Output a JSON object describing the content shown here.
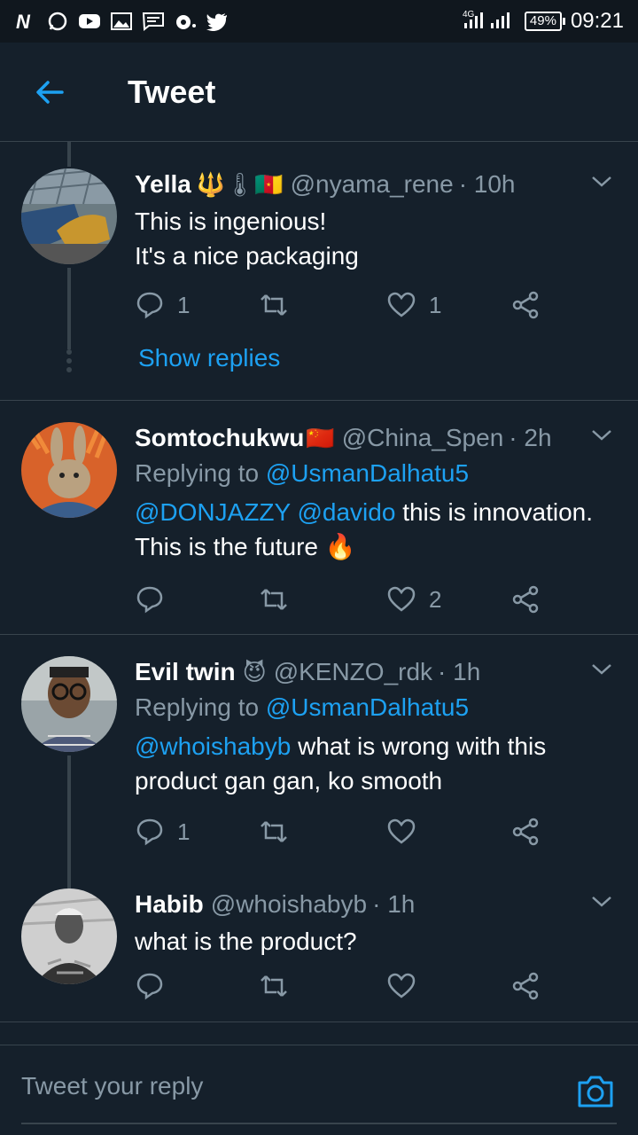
{
  "status_bar": {
    "left_icons": [
      "netflix-n-icon",
      "whatsapp-icon",
      "youtube-icon",
      "gallery-icon",
      "message-icon",
      "music-icon",
      "twitter-icon"
    ],
    "network": "4G",
    "battery": "49%",
    "time": "09:21"
  },
  "header": {
    "title": "Tweet"
  },
  "tweets": [
    {
      "name": "Yella",
      "badges": "🔱🌡🇨🇲",
      "handle": "@nyama_rene",
      "time": "· 10h",
      "replying_label": "",
      "replying_to": "",
      "text_lines": [
        "This is ingenious!",
        "It's a nice packaging"
      ],
      "reply_count": "1",
      "like_count": "1",
      "show_replies": "Show replies"
    },
    {
      "name": "Somtochukwu",
      "badges": "🇨🇳",
      "handle": "@China_Spen",
      "time": "· 2h",
      "replying_label": "Replying to",
      "replying_to": "@UsmanDalhatu5",
      "mention_1": "@DONJAZZY",
      "mention_2": "@davido",
      "text_after": "this is innovation.",
      "text_line2": "This is the future 🔥",
      "reply_count": "",
      "like_count": "2"
    },
    {
      "name": "Evil twin",
      "badges": "😈",
      "handle": "@KENZO_rdk",
      "time": "· 1h",
      "replying_label": "Replying to",
      "replying_to": "@UsmanDalhatu5",
      "mention_1": "@whoishabyb",
      "text_after": "what is wrong with this",
      "text_line2": "product gan gan, ko smooth",
      "reply_count": "1",
      "like_count": ""
    },
    {
      "name": "Habib",
      "handle": "@whoishabyb",
      "time": "· 1h",
      "text": "what is the product?",
      "reply_count": "",
      "like_count": ""
    }
  ],
  "reply_bar": {
    "placeholder": "Tweet your reply"
  },
  "colors": {
    "background": "#15202b",
    "accent": "#1da1f2",
    "muted": "#8899a6",
    "divider": "#38444d"
  }
}
